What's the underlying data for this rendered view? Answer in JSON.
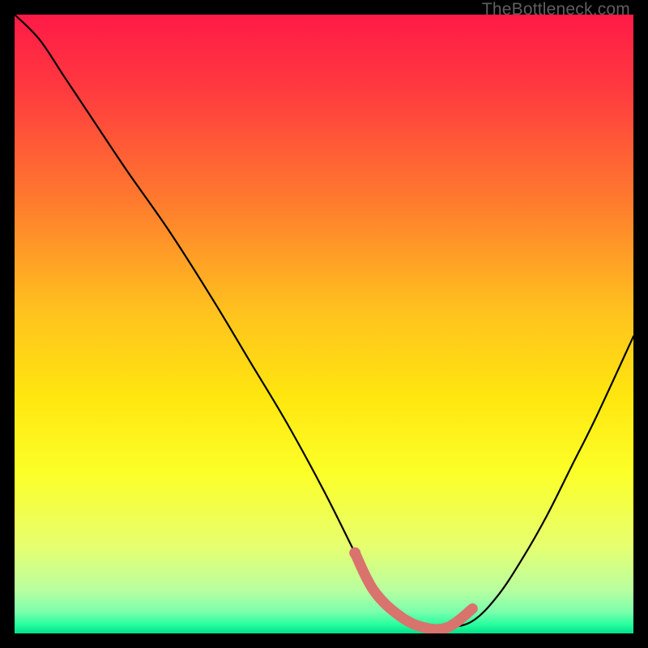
{
  "watermark": "TheBottleneck.com",
  "chart_data": {
    "type": "line",
    "title": "",
    "xlabel": "",
    "ylabel": "",
    "xlim": [
      0,
      100
    ],
    "ylim": [
      0,
      100
    ],
    "gradient_stops": [
      {
        "offset": 0.0,
        "color": "#ff1a47"
      },
      {
        "offset": 0.12,
        "color": "#ff3a3f"
      },
      {
        "offset": 0.3,
        "color": "#ff7a2e"
      },
      {
        "offset": 0.48,
        "color": "#ffc21e"
      },
      {
        "offset": 0.62,
        "color": "#ffe70f"
      },
      {
        "offset": 0.74,
        "color": "#fcff28"
      },
      {
        "offset": 0.86,
        "color": "#e6ff70"
      },
      {
        "offset": 0.93,
        "color": "#b8ffa0"
      },
      {
        "offset": 0.965,
        "color": "#7cffac"
      },
      {
        "offset": 0.985,
        "color": "#2aff9f"
      },
      {
        "offset": 1.0,
        "color": "#00e28a"
      }
    ],
    "series": [
      {
        "name": "bottleneck-curve",
        "x": [
          0,
          4,
          8,
          12,
          18,
          25,
          32,
          38,
          44,
          50,
          55,
          58,
          62,
          66,
          70,
          74,
          78,
          82,
          86,
          90,
          94,
          100
        ],
        "y": [
          100,
          96,
          90,
          84,
          75,
          65,
          54,
          44,
          34,
          23,
          13,
          7,
          3,
          1,
          1,
          2,
          6,
          12,
          19,
          27,
          35,
          48
        ]
      }
    ],
    "highlight": {
      "name": "selected-segment",
      "color": "#d9736e",
      "dot_radius_px": 7,
      "stroke_width_px": 13,
      "x": [
        55,
        58,
        62,
        66,
        70,
        74
      ],
      "y": [
        13,
        7,
        3,
        1,
        1,
        4
      ]
    }
  }
}
